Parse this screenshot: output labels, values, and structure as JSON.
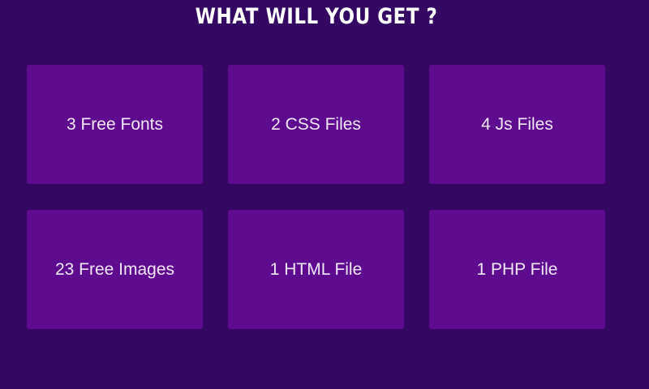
{
  "section": {
    "title": "WHAT WILL YOU GET ?"
  },
  "cards": [
    {
      "label": "3 Free Fonts"
    },
    {
      "label": "2 CSS Files"
    },
    {
      "label": "4 Js Files"
    },
    {
      "label": "23 Free Images"
    },
    {
      "label": "1 HTML File"
    },
    {
      "label": "1 PHP File"
    }
  ],
  "colors": {
    "background": "#340862",
    "card": "#5f0b8f",
    "text": "#ffffff"
  }
}
